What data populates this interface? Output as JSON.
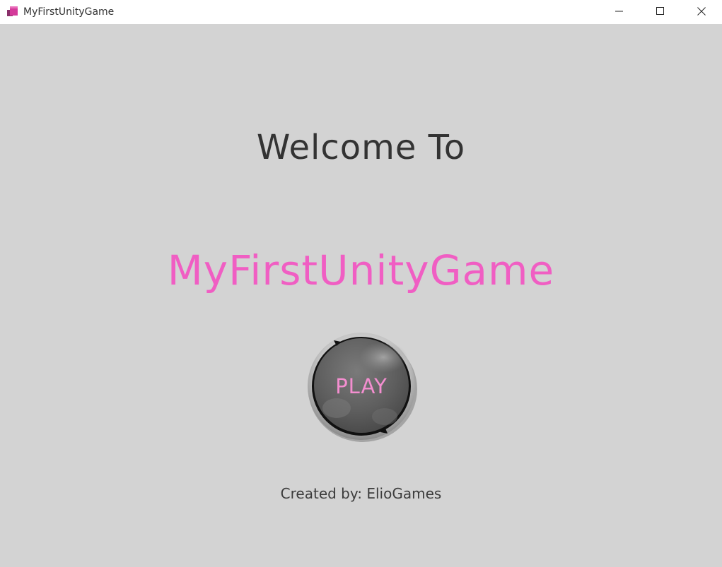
{
  "window": {
    "title": "MyFirstUnityGame",
    "controls": {
      "minimize_icon": "minimize-icon",
      "maximize_icon": "maximize-icon",
      "close_icon": "close-icon"
    }
  },
  "menu": {
    "welcome_text": "Welcome To",
    "game_title": "MyFirstUnityGame",
    "play_label": "PLAY",
    "credits": "Created by: ElioGames"
  },
  "colors": {
    "background": "#d3d3d3",
    "title_accent": "#f05ec3",
    "play_text": "#f48ed0",
    "button_body": "#5e5e5e",
    "text_dark": "#333333"
  }
}
